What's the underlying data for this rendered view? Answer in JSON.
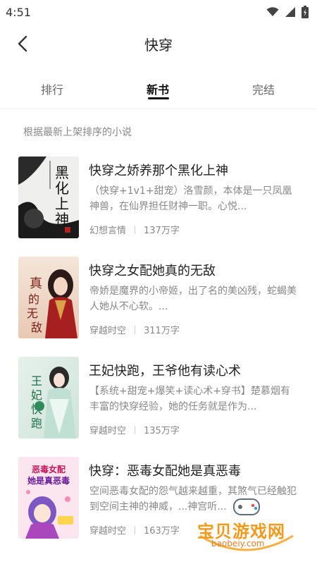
{
  "status_bar": {
    "time": "4:51"
  },
  "header": {
    "title": "快穿"
  },
  "tabs": [
    {
      "label": "排行",
      "active": false
    },
    {
      "label": "新书",
      "active": true
    },
    {
      "label": "完结",
      "active": false
    }
  ],
  "subtitle": "根据最新上架排序的小说",
  "books": [
    {
      "title": "快穿之娇养那个黑化上神",
      "desc": "（快穿+1v1+甜宠）洛雪颜，本体是一只凤凰神兽，在仙界担任财神一职。心悦...",
      "category": "幻想言情",
      "words": "137万字",
      "cover_text": "黑化上神"
    },
    {
      "title": "快穿之女配她真的无敌",
      "desc": "帝娇是魔界的小帝姬，出了名的美凶残，蛇蝎美人她从不心软。...",
      "category": "穿越时空",
      "words": "311万字",
      "cover_text": "真的无敌"
    },
    {
      "title": "王妃快跑，王爷他有读心术",
      "desc": "【系统+甜宠+爆笑+读心术+穿书】楚慕烟有丰富的快穿经验，她的任务就是作为...",
      "category": "穿越时空",
      "words": "135万字",
      "cover_text": "王妃快跑"
    },
    {
      "title": "快穿：恶毒女配她是真恶毒",
      "desc": "空间恶毒女配的怨气越来越重，其煞气已经触犯到空间主神的神威，...神宫听...",
      "category": "穿越时空",
      "words": "163万字",
      "cover_text": "恶毒女配她是真恶毒"
    }
  ],
  "watermark": {
    "text": "宝贝游戏网",
    "url": "baobeiy.com"
  }
}
